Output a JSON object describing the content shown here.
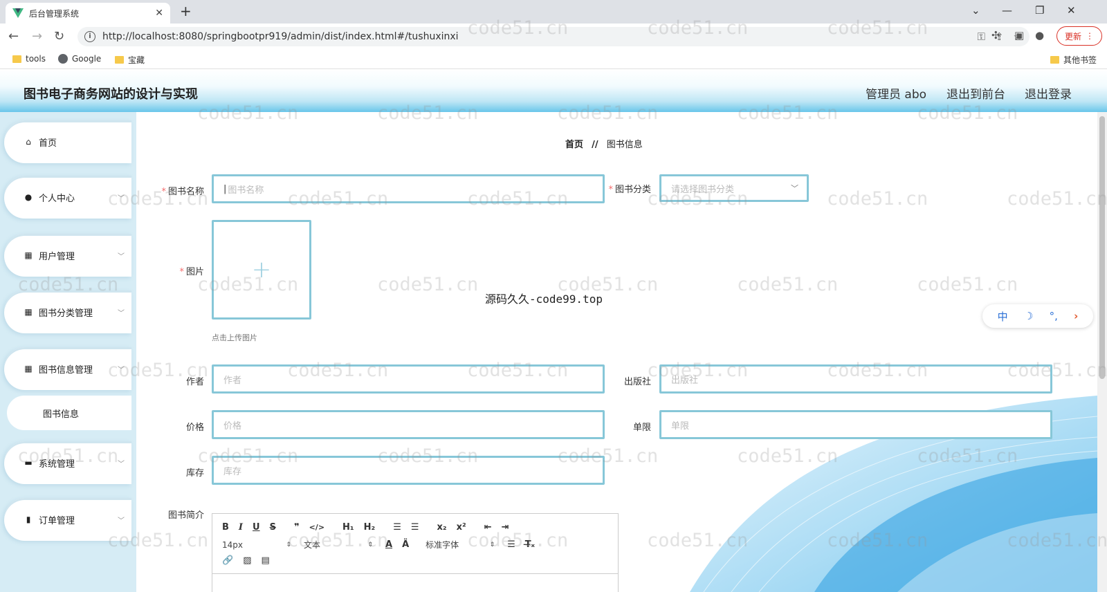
{
  "browser": {
    "tab_title": "后台管理系统",
    "url": "http://localhost:8080/springbootpr919/admin/dist/index.html#/tushuxinxi",
    "update_label": "更新",
    "bookmarks": [
      "tools",
      "Google",
      "宝藏"
    ],
    "other_bookmarks": "其他书签"
  },
  "header": {
    "title": "图书电子商务网站的设计与实现",
    "admin": "管理员 abo",
    "exit_front": "退出到前台",
    "logout": "退出登录"
  },
  "sidebar": {
    "items": [
      {
        "label": "首页",
        "icon": "home-icon"
      },
      {
        "label": "个人中心",
        "icon": "user-icon"
      },
      {
        "label": "用户管理",
        "icon": "grid-icon"
      },
      {
        "label": "图书分类管理",
        "icon": "grid-icon"
      },
      {
        "label": "图书信息管理",
        "icon": "grid-icon"
      },
      {
        "label": "系统管理",
        "icon": "briefcase-icon"
      },
      {
        "label": "订单管理",
        "icon": "bar-chart-icon"
      }
    ],
    "sub_item": "图书信息"
  },
  "breadcrumb": {
    "home": "首页",
    "sep": "//",
    "current": "图书信息"
  },
  "form": {
    "book_name_label": "图书名称",
    "book_name_placeholder": "图书名称",
    "category_label": "图书分类",
    "category_placeholder": "请选择图书分类",
    "image_label": "图片",
    "upload_tip": "点击上传图片",
    "author_label": "作者",
    "author_placeholder": "作者",
    "publisher_label": "出版社",
    "publisher_placeholder": "出版社",
    "price_label": "价格",
    "price_placeholder": "价格",
    "limit_label": "单限",
    "limit_placeholder": "单限",
    "stock_label": "库存",
    "stock_placeholder": "库存",
    "intro_label": "图书简介"
  },
  "editor": {
    "font_size": "14px",
    "text_type": "文本",
    "font_family": "标准字体"
  },
  "watermark": "code51.cn",
  "center_mark": "源码久久-code99.top",
  "ime": {
    "lang": "中"
  }
}
